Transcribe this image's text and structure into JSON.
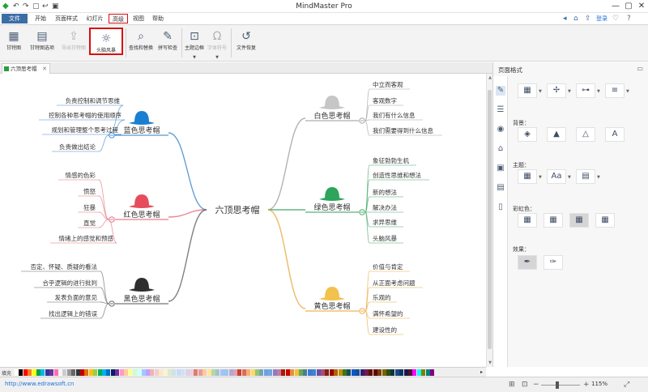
{
  "titlebar": {
    "title": "MindMaster Pro",
    "quick_access": [
      "↶",
      "↷",
      "▢",
      "↩",
      "▣"
    ],
    "right_icons": [
      "◂",
      "⌂",
      "⇪"
    ],
    "login": "登录",
    "extra_icons": [
      "♡",
      "?"
    ],
    "window_buttons": [
      "—",
      "▢",
      "✕"
    ]
  },
  "menu": {
    "file": "文件",
    "items": [
      "开始",
      "页面样式",
      "幻灯片",
      "高级",
      "视图",
      "帮助"
    ]
  },
  "ribbon": {
    "buttons": [
      {
        "label": "甘特图",
        "icon": "▦"
      },
      {
        "label": "甘特图选项",
        "icon": "▤"
      },
      {
        "label": "导出甘特图",
        "icon": "⇪"
      },
      {
        "label": "头脑风暴",
        "icon": "☼"
      },
      {
        "label": "查找和替换",
        "icon": "⌕"
      },
      {
        "label": "拼写检查",
        "icon": "✎"
      },
      {
        "label": "主题边框",
        "icon": "⊡"
      },
      {
        "label": "字体符号",
        "icon": "Ω"
      },
      {
        "label": "文件恢复",
        "icon": "↺"
      }
    ]
  },
  "tab": {
    "label": "六顶思考帽",
    "close": "✕"
  },
  "mindmap": {
    "center": "六顶思考帽",
    "branches": [
      {
        "label": "蓝色思考帽",
        "color": "#2f7fc7",
        "hat": "#1a7fd1",
        "items": [
          "负责控制和调节思维",
          "控制各种思考帽的使用顺序",
          "规划和管理整个思考过程",
          "负责做出结论"
        ]
      },
      {
        "label": "红色思考帽",
        "color": "#e3606e",
        "hat": "#e54d5c",
        "items": [
          "情感的色彩",
          "愤怒",
          "狂暴",
          "直觉",
          "情绪上的感觉和预感"
        ]
      },
      {
        "label": "黑色思考帽",
        "color": "#555555",
        "hat": "#2f2f2f",
        "items": [
          "否定、怀疑、质疑的看法",
          "合乎逻辑的进行批判",
          "发表负面的意见",
          "找出逻辑上的错误"
        ]
      },
      {
        "label": "白色思考帽",
        "color": "#9a9a9a",
        "hat": "#c6c6c6",
        "items": [
          "中立而客观",
          "客观数字",
          "我们有什么信息",
          "我们需要得到什么信息"
        ]
      },
      {
        "label": "绿色思考帽",
        "color": "#2e9e58",
        "hat": "#2fa45b",
        "items": [
          "象征勃勃生机",
          "创造性思维和想法",
          "新的想法",
          "解决办法",
          "求异思维",
          "头脑风暴"
        ]
      },
      {
        "label": "黄色思考帽",
        "color": "#e6a32d",
        "hat": "#f2c14e",
        "items": [
          "价值与肯定",
          "从正面考虑问题",
          "乐观的",
          "满怀希望的",
          "建设性的"
        ]
      }
    ]
  },
  "panel": {
    "title": "页面格式",
    "pin": "▭",
    "sections": {
      "background": "背景：",
      "theme": "主题：",
      "rainbow": "彩虹色：",
      "effect": "效果："
    }
  },
  "palette": {
    "label": "填充",
    "more": "▸",
    "colors": [
      "#ffffff",
      "#000000",
      "#ff0000",
      "#ff8000",
      "#ffff00",
      "#00a651",
      "#00b7ef",
      "#2f3699",
      "#6f3198",
      "#ff6eb4",
      "#f5f5f5",
      "#cccccc",
      "#999999",
      "#666666",
      "#333333",
      "#c00000",
      "#e46c0a",
      "#ffc000",
      "#92d050",
      "#00b050",
      "#00b0f0",
      "#0070c0",
      "#002060",
      "#7030a0",
      "#ff99cc",
      "#ffcc99",
      "#ffff99",
      "#ccffcc",
      "#ccffff",
      "#99ccff",
      "#cc99ff",
      "#e6b8af",
      "#f4cccc",
      "#fce5cd",
      "#fff2cc",
      "#d9ead3",
      "#d0e0e3",
      "#c9daf8",
      "#cfe2f3",
      "#d9d2e9",
      "#ead1dc",
      "#dd7e6b",
      "#ea9999",
      "#f9cb9c",
      "#ffe599",
      "#b6d7a8",
      "#a2c4c9",
      "#a4c2f4",
      "#9fc5e8",
      "#b4a7d6",
      "#d5a6bd",
      "#cc4125",
      "#e06666",
      "#f6b26b",
      "#ffd966",
      "#93c47d",
      "#76a5af",
      "#6d9eeb",
      "#6fa8dc",
      "#8e7cc3",
      "#c27ba0",
      "#a61c00",
      "#cc0000",
      "#e69138",
      "#f1c232",
      "#6aa84f",
      "#45818e",
      "#3c78d8",
      "#3d85c6",
      "#674ea7",
      "#a64d79",
      "#85200c",
      "#990000",
      "#b45f06",
      "#bf9000",
      "#38761d",
      "#134f5c",
      "#1155cc",
      "#0b5394",
      "#351c75",
      "#741b47",
      "#5b0f00",
      "#660000",
      "#783f04",
      "#7f6000",
      "#274e13",
      "#0c343d",
      "#1c4587",
      "#073763",
      "#20124d",
      "#4c1130",
      "#ff00ff",
      "#00ffff",
      "#808000",
      "#008080",
      "#800080"
    ]
  },
  "status": {
    "link": "http://www.edrawsoft.cn",
    "zoom": "115%",
    "icons": [
      "⊞",
      "⊡",
      "−",
      "+",
      "⤢"
    ]
  }
}
